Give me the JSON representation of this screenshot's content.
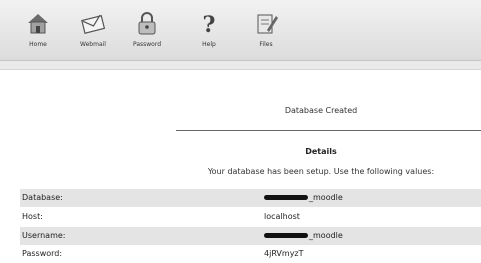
{
  "toolbar": {
    "items": [
      {
        "label": "Home",
        "icon": "home-icon"
      },
      {
        "label": "Webmail",
        "icon": "webmail-icon"
      },
      {
        "label": "Password",
        "icon": "lock-icon"
      },
      {
        "label": "Help",
        "icon": "question-icon"
      },
      {
        "label": "Files",
        "icon": "files-icon"
      }
    ]
  },
  "main": {
    "status_title": "Database Created",
    "details_heading": "Details",
    "instructions": "Your database has been setup. Use the following values:",
    "fields": [
      {
        "key": "Database:",
        "value": "_moodle",
        "redacted": true
      },
      {
        "key": "Host:",
        "value": "localhost",
        "redacted": false
      },
      {
        "key": "Username:",
        "value": "_moodle",
        "redacted": true
      },
      {
        "key": "Password:",
        "value": "4jRVmyzT",
        "redacted": false
      }
    ]
  },
  "colors": {
    "row_shade": "#e4e4e4",
    "divider": "#666666",
    "redaction": "#111111"
  }
}
